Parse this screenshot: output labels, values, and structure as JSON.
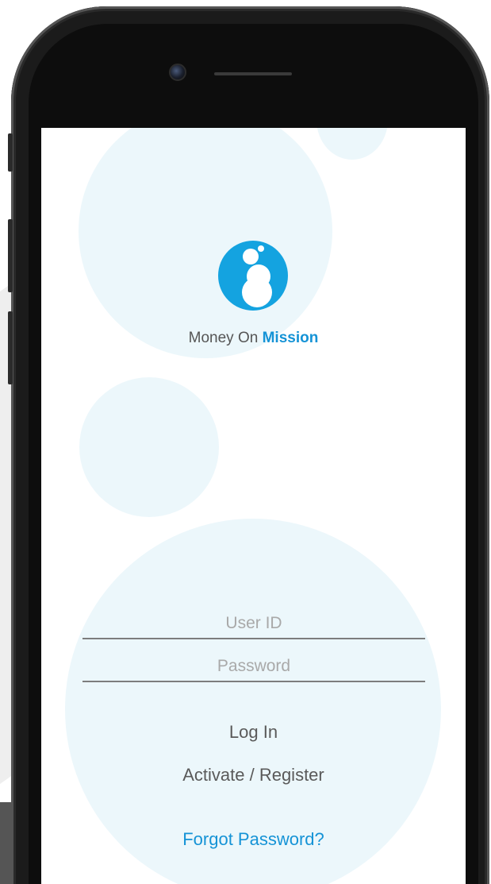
{
  "app": {
    "brand_prefix": "Money On ",
    "brand_accent": "Mission",
    "logo_icon": "bubbles-logo-icon"
  },
  "login_form": {
    "user_id_placeholder": "User ID",
    "password_placeholder": "Password",
    "login_label": "Log In",
    "register_label": "Activate / Register",
    "forgot_label": "Forgot Password?"
  },
  "colors": {
    "accent": "#1593d6",
    "logo": "#14a3e0",
    "bubble": "#ecf7fb",
    "text": "#555555"
  }
}
